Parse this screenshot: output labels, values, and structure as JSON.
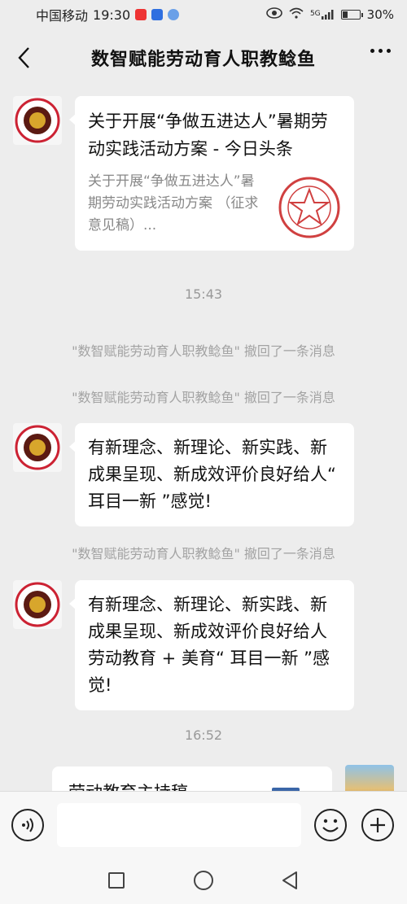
{
  "status_bar": {
    "carrier": "中国移动",
    "time": "19:30",
    "network": "5G",
    "battery": "30%",
    "battery_level": 0.3
  },
  "header": {
    "title": "数智赋能劳动育人职教鲶鱼"
  },
  "messages": [
    {
      "type": "card",
      "title": "关于开展“争做五进达人”暑期劳动实践活动方案 - 今日头条",
      "description": "关于开展“争做五进达人”暑期劳动实践活动方案 （征求意见稿）..."
    },
    {
      "type": "time",
      "text": "15:43"
    },
    {
      "type": "system",
      "text": "\"数智赋能劳动育人职教鲶鱼\" 撤回了一条消息"
    },
    {
      "type": "system",
      "text": "\"数智赋能劳动育人职教鲶鱼\" 撤回了一条消息"
    },
    {
      "type": "text",
      "text": "有新理念、新理论、新实践、新成果呈现、新成效评价良好给人“ 耳目一新 ”感觉!"
    },
    {
      "type": "system",
      "text": "\"数智赋能劳动育人职教鲶鱼\" 撤回了一条消息"
    },
    {
      "type": "text",
      "text": "有新理念、新理论、新实践、新成果呈现、新成效评价良好给人劳动教育 + 美育“ 耳目一新 ”感觉!"
    },
    {
      "type": "time",
      "text": "16:52"
    },
    {
      "type": "card_partial",
      "title": "劳动教育主持稿"
    }
  ],
  "input": {
    "placeholder": ""
  },
  "colors": {
    "background": "#ededed",
    "bubble": "#ffffff",
    "system_text": "#a3a3a3"
  }
}
